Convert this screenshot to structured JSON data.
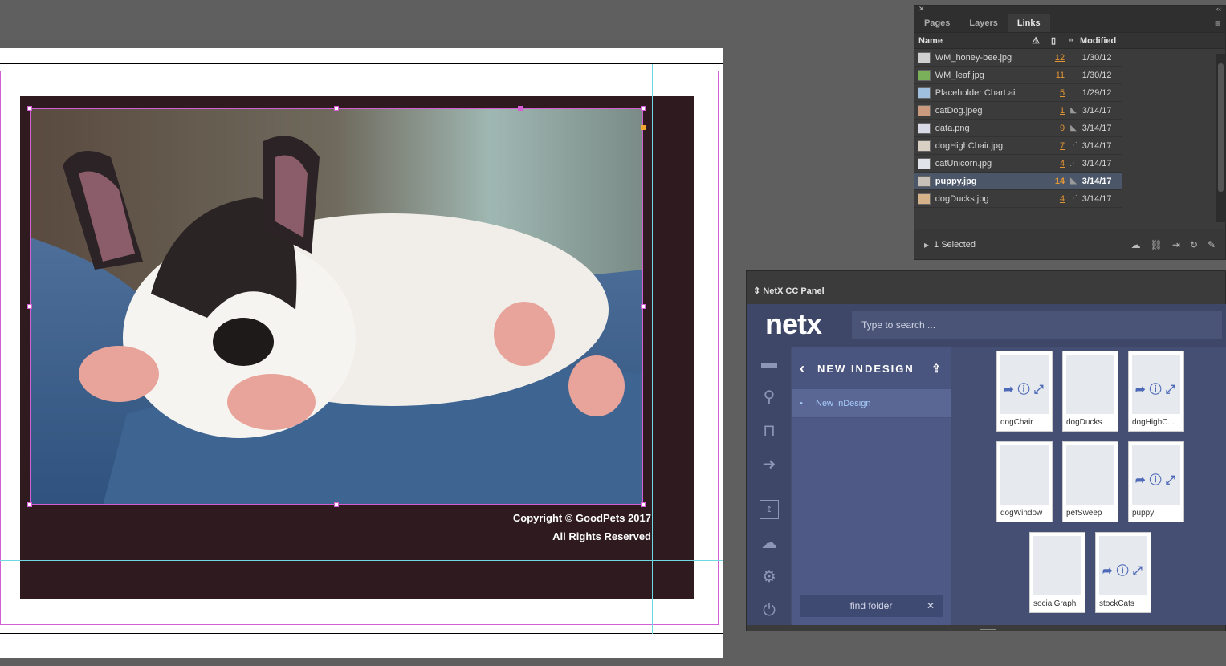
{
  "document": {
    "copyright_line1": "Copyright © GoodPets 2017",
    "copyright_line2": "All Rights Reserved"
  },
  "links_panel": {
    "tabs": [
      "Pages",
      "Layers",
      "Links"
    ],
    "active_tab": "Links",
    "columns": {
      "name": "Name",
      "modified": "Modified"
    },
    "rows": [
      {
        "name": "WM_honey-bee.jpg",
        "page": "12",
        "modified": "1/30/12",
        "thumb": "#cfcfcf",
        "mark": ""
      },
      {
        "name": "WM_leaf.jpg",
        "page": "11",
        "modified": "1/30/12",
        "thumb": "#7bb05a",
        "mark": ""
      },
      {
        "name": "Placeholder Chart.ai",
        "page": "5",
        "modified": "1/29/12",
        "thumb": "#9fc0de",
        "mark": ""
      },
      {
        "name": "catDog.jpeg",
        "page": "1",
        "modified": "3/14/17",
        "thumb": "#c99a7e",
        "mark": "◣"
      },
      {
        "name": "data.png",
        "page": "9",
        "modified": "3/14/17",
        "thumb": "#d8dbe6",
        "mark": "◣"
      },
      {
        "name": "dogHighChair.jpg",
        "page": "7",
        "modified": "3/14/17",
        "thumb": "#d9cfc2",
        "mark": "⋰"
      },
      {
        "name": "catUnicorn.jpg",
        "page": "4",
        "modified": "3/14/17",
        "thumb": "#e0e3ea",
        "mark": "⋰"
      },
      {
        "name": "puppy.jpg",
        "page": "14",
        "modified": "3/14/17",
        "thumb": "#c6c0b8",
        "mark": "◣",
        "selected": true
      },
      {
        "name": "dogDucks.jpg",
        "page": "4",
        "modified": "3/14/17",
        "thumb": "#d6b28a",
        "mark": "⋰"
      }
    ],
    "footer_status": "1 Selected"
  },
  "netx_panel": {
    "tab_title": "NetX CC Panel",
    "logo": "netx",
    "search_placeholder": "Type to search ...",
    "folder_title": "NEW INDESIGN",
    "folder_item": "New InDesign",
    "find_folder": "find folder",
    "assets": [
      {
        "label": "dogChair",
        "overlay": true
      },
      {
        "label": "dogDucks",
        "overlay": false
      },
      {
        "label": "dogHighC...",
        "overlay": true
      },
      {
        "label": "dogWindow",
        "overlay": false
      },
      {
        "label": "petSweep",
        "overlay": false
      },
      {
        "label": "puppy",
        "overlay": true
      },
      {
        "label": "socialGraph",
        "overlay": false
      },
      {
        "label": "stockCats",
        "overlay": true
      }
    ]
  }
}
